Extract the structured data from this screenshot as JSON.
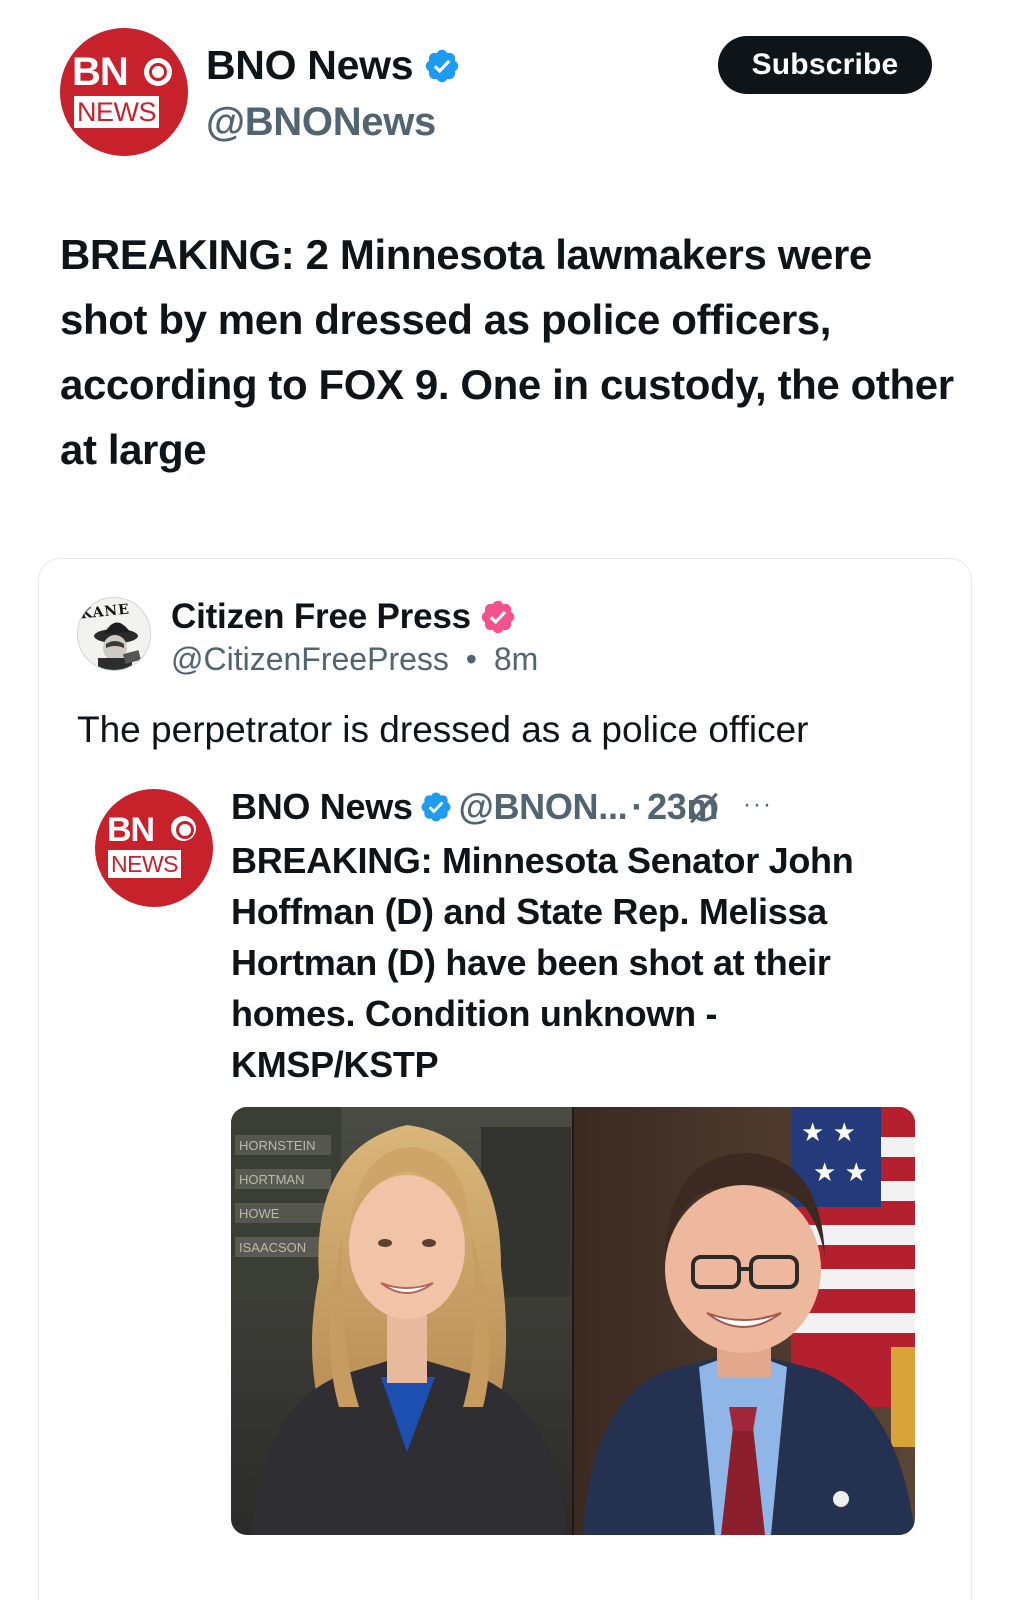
{
  "post": {
    "author_name": "BNO News",
    "author_handle": "@BNONews",
    "subscribe_label": "Subscribe",
    "avatar_logo_top": "BN",
    "avatar_logo_bottom": "NEWS",
    "text": "BREAKING: 2 Minnesota lawmakers were shot by men dressed as police officers, according to FOX 9. One in custody, the other at large"
  },
  "quote": {
    "author_name": "Citizen Free Press",
    "author_handle": "@CitizenFreePress",
    "separator": "•",
    "time": "8m",
    "avatar_text": "KANE",
    "text": "The perpetrator is dressed as a police officer",
    "inner": {
      "author_name": "BNO News",
      "author_handle": "@BNON...",
      "separator": "·",
      "time": "23m",
      "more_label": "···",
      "text": "BREAKING: Minnesota Senator John Hoffman (D) and State Rep. Melissa Hortman (D) have been shot at their homes. Condition unknown - KMSP/KSTP",
      "board_names": [
        "HORNSTEIN",
        "HORTMAN",
        "HOWE",
        "ISAACSON"
      ]
    }
  },
  "colors": {
    "bno_red": "#c7212b",
    "verified_blue": "#1d9bf0",
    "verified_pink": "#f4528c",
    "text_primary": "#0f1419",
    "text_secondary": "#536471"
  },
  "icons": {
    "verified": "verified-badge-icon",
    "grok": "grok-icon",
    "more": "more-icon"
  }
}
